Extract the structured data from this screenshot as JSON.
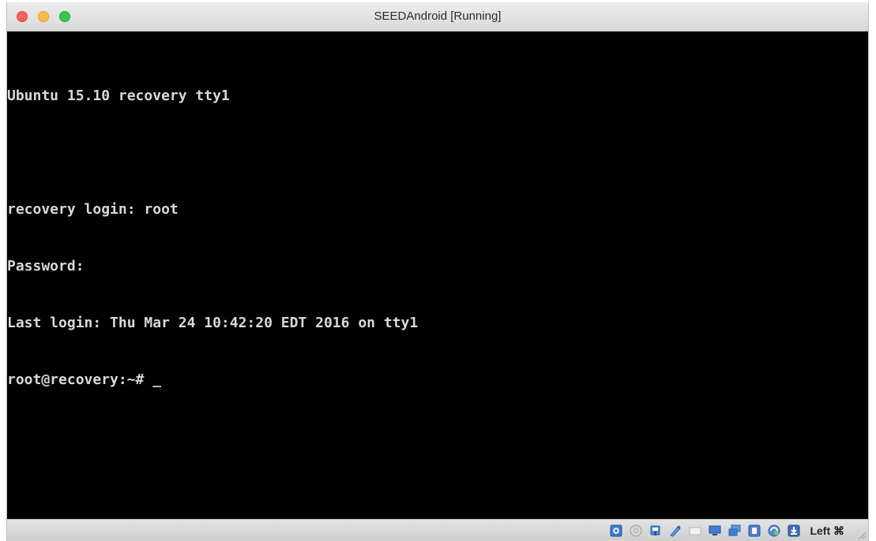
{
  "window": {
    "title": "SEEDAndroid [Running]"
  },
  "terminal": {
    "lines": [
      "Ubuntu 15.10 recovery tty1",
      "",
      "recovery login: root",
      "Password:",
      "Last login: Thu Mar 24 10:42:20 EDT 2016 on tty1"
    ],
    "prompt": "root@recovery:~# ",
    "cursor": "_"
  },
  "statusbar": {
    "icons": [
      "hard-disk-icon",
      "optical-drive-icon",
      "audio-icon",
      "network-icon",
      "usb-icon",
      "shared-folders-icon",
      "display-icon",
      "video-capture-icon",
      "virtualization-icon",
      "mouse-integration-icon",
      "keyboard-capture-icon"
    ],
    "host_key": "Left ⌘"
  }
}
